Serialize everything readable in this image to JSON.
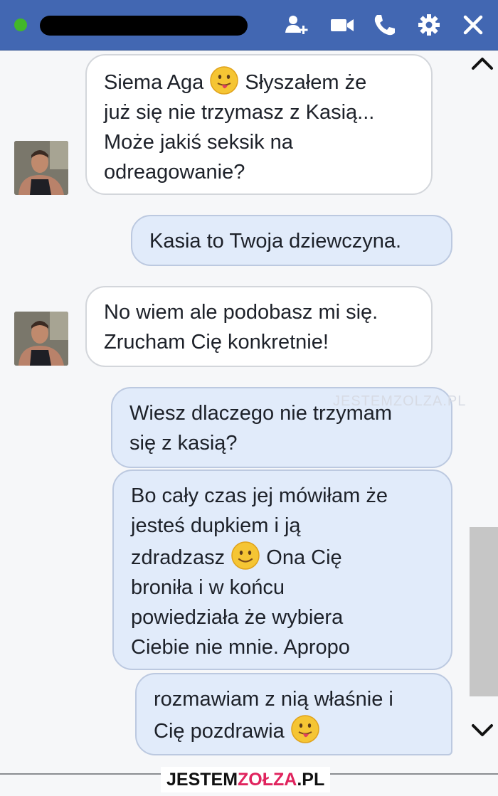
{
  "header": {
    "online": true,
    "contact_name_redacted": true,
    "icons": [
      "add-person-icon",
      "video-camera-icon",
      "phone-icon",
      "gear-icon",
      "close-icon"
    ],
    "color": "#4267b2"
  },
  "messages": [
    {
      "from": "them",
      "text1": "Siema Aga",
      "emoji1": "tongue-out-emoji",
      "text2": "Słyszałem że",
      "lines": [
        "już się nie trzymasz z Kasią...",
        "Może jakiś seksik na",
        "odreagowanie?"
      ]
    },
    {
      "from": "me",
      "text": "Kasia to Twoja dziewczyna."
    },
    {
      "from": "them",
      "lines": [
        "No wiem ale podobasz mi się.",
        "Zrucham Cię konkretnie!"
      ]
    },
    {
      "from": "me",
      "lines": [
        "Wiesz dlaczego nie trzymam",
        "się z kasią?"
      ]
    },
    {
      "from": "me",
      "line1": "Bo cały czas jej mówiłam że",
      "line2": "jesteś dupkiem i ją",
      "line3a": "zdradzasz",
      "emoji": "smile-emoji",
      "line3b": "Ona Cię",
      "line4": "broniła i w końcu",
      "line5": "powiedziała że wybiera",
      "line6": "Ciebie nie mnie. Apropo"
    },
    {
      "from": "me",
      "line1": "rozmawiam z nią właśnie i",
      "line2a": "Cię pozdrawia",
      "emoji": "tongue-out-emoji"
    }
  ],
  "watermark_inline": "JESTEMZOLZA.PL",
  "footer": {
    "brand_a": "JESTEM",
    "brand_b": "ZOŁZA",
    "brand_c": ".PL"
  },
  "colors": {
    "incoming": "#ffffff",
    "outgoing": "#e1ebfa",
    "online": "#42b72a"
  }
}
